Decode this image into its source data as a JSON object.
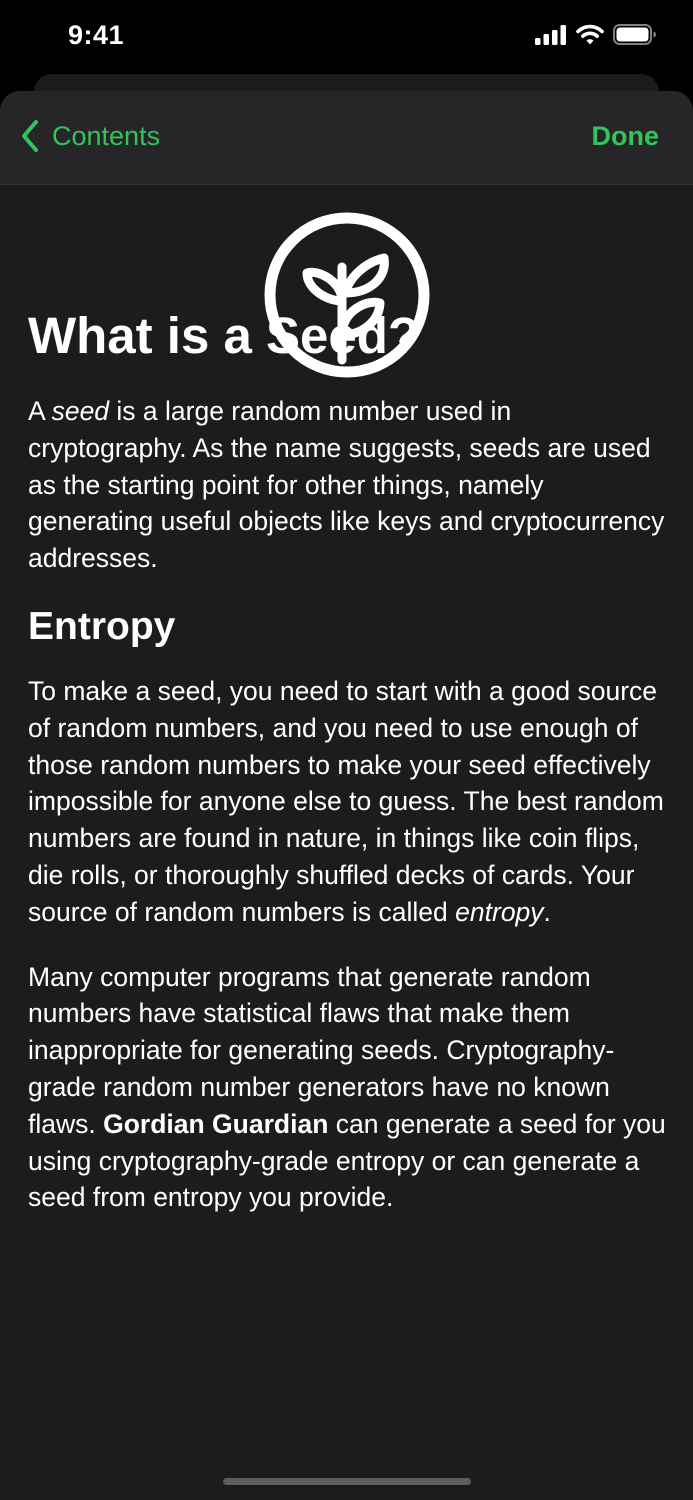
{
  "status_bar": {
    "time": "9:41"
  },
  "nav": {
    "back_label": "Contents",
    "done_label": "Done"
  },
  "colors": {
    "accent": "#32c35a",
    "background": "#1c1c1e",
    "navbar": "#262628"
  },
  "article": {
    "title": "What is a Seed?",
    "intro": {
      "pre": "A ",
      "em": "seed",
      "post": " is a large random number used in cryptography. As the name suggests, seeds are used as the starting point for other things, namely generating useful objects like keys and cryptocurrency addresses."
    },
    "section_title": "Entropy",
    "para2": {
      "pre": "To make a seed, you need to start with a good source of random numbers, and you need to use enough of those random numbers to make your seed effectively impossible for anyone else to guess. The best random numbers are found in nature, in things like coin flips, die rolls, or thoroughly shuffled decks of cards. Your source of random numbers is called ",
      "em": "entropy",
      "post": "."
    },
    "para3": {
      "pre": "Many computer programs that generate random numbers have statistical flaws that make them inappropriate for generating seeds. Cryptography-grade random number generators have no known flaws. ",
      "strong": "Gordian Guardian",
      "post": " can generate a seed for you using cryptography-grade entropy or can generate a seed from entropy you provide."
    }
  },
  "icons": [
    "cellular-signal-icon",
    "wifi-icon",
    "battery-icon",
    "chevron-left-icon",
    "seed-sprout-icon"
  ]
}
